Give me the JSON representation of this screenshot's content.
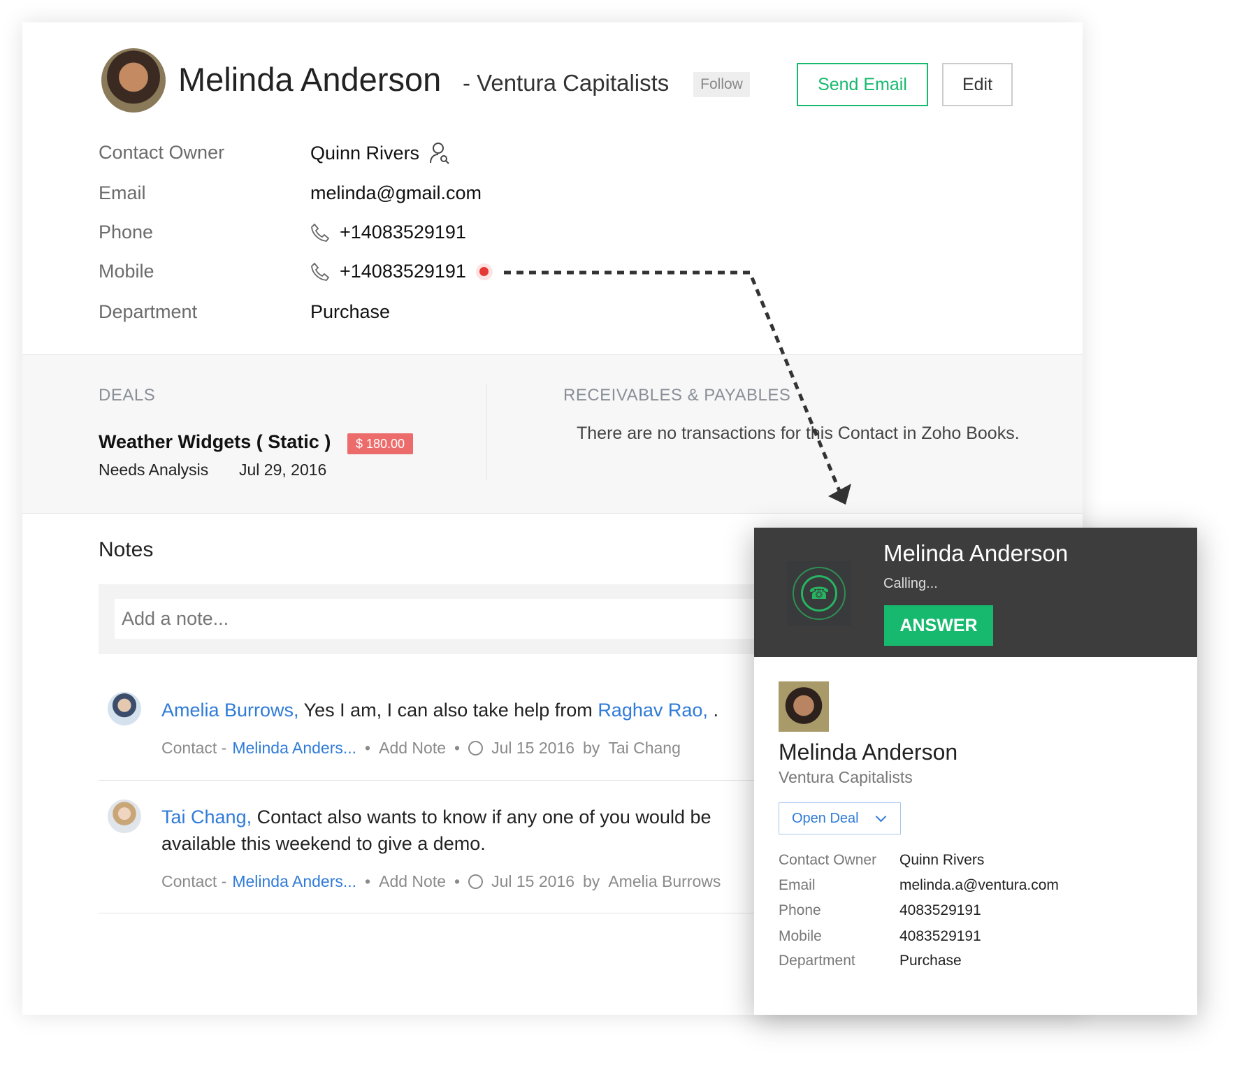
{
  "header": {
    "name": "Melinda Anderson",
    "company": "- Ventura Capitalists",
    "follow_label": "Follow",
    "send_email_label": "Send Email",
    "edit_label": "Edit"
  },
  "fields": [
    {
      "label": "Contact Owner",
      "value": "Quinn Rivers"
    },
    {
      "label": "Email",
      "value": "melinda@gmail.com"
    },
    {
      "label": "Phone",
      "value": "+14083529191"
    },
    {
      "label": "Mobile",
      "value": "+14083529191"
    },
    {
      "label": "Department",
      "value": "Purchase"
    }
  ],
  "deals": {
    "heading": "DEALS",
    "title": "Weather Widgets ( Static )",
    "amount": "$ 180.00",
    "stage": "Needs Analysis",
    "date": "Jul 29, 2016"
  },
  "receivables": {
    "heading": "RECEIVABLES & PAYABLES",
    "empty_text": "There are no transactions for this Contact in Zoho Books."
  },
  "notes": {
    "heading": "Notes",
    "placeholder": "Add a note...",
    "items": [
      {
        "author": "Amelia Burrows,",
        "text": "Yes I am, I can also take help from",
        "mention": "Raghav Rao,",
        "tail": ".",
        "meta_prefix": "Contact -",
        "meta_link": "Melinda Anders...",
        "add_note": "Add Note",
        "time": "Jul 15 2016",
        "by": "by",
        "by_name": "Tai Chang"
      },
      {
        "author": "Tai Chang,",
        "text": "Contact also wants to know if any one of you would be available this weekend to give a demo.",
        "meta_prefix": "Contact -",
        "meta_link": "Melinda Anders...",
        "add_note": "Add Note",
        "time": "Jul 15 2016",
        "by": "by",
        "by_name": "Amelia Burrows"
      }
    ]
  },
  "call": {
    "name": "Melinda Anderson",
    "status": "Calling...",
    "answer_label": "ANSWER",
    "contact_name": "Melinda Anderson",
    "company": "Ventura Capitalists",
    "open_deal_label": "Open Deal",
    "fields": [
      {
        "label": "Contact Owner",
        "value": "Quinn Rivers"
      },
      {
        "label": "Email",
        "value": "melinda.a@ventura.com"
      },
      {
        "label": "Phone",
        "value": "4083529191"
      },
      {
        "label": "Mobile",
        "value": "4083529191"
      },
      {
        "label": "Department",
        "value": "Purchase"
      }
    ]
  },
  "colors": {
    "accent_green": "#17b96e",
    "link_blue": "#2f7bd8",
    "badge_red": "#ec6b6b",
    "dark_header": "#3d3d3d"
  }
}
